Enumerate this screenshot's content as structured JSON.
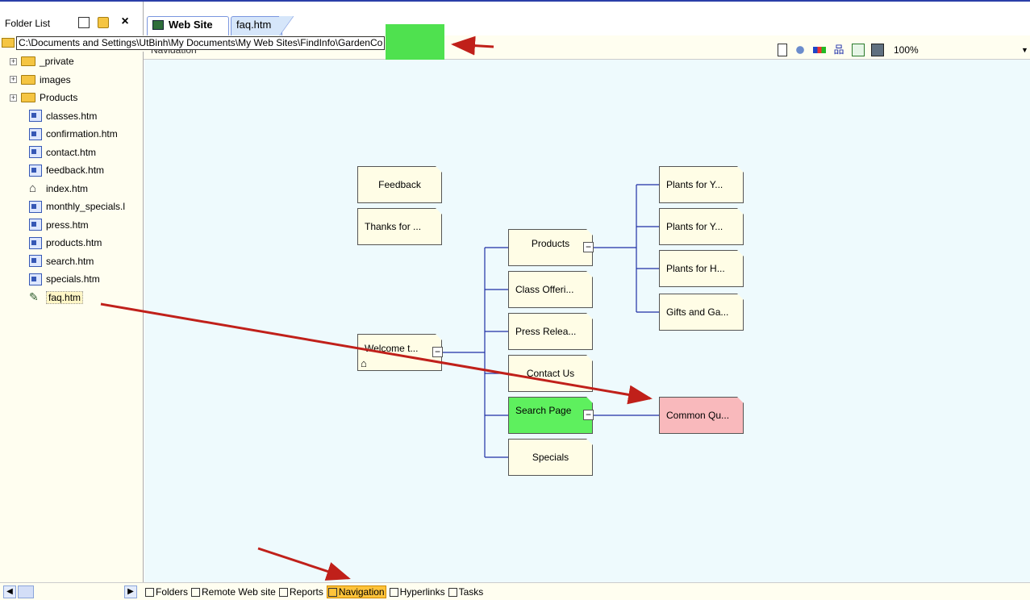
{
  "folder_list": {
    "title": "Folder List",
    "items": [
      {
        "label": "_private",
        "type": "folder"
      },
      {
        "label": "images",
        "type": "folder"
      },
      {
        "label": "Products",
        "type": "folder"
      },
      {
        "label": "classes.htm",
        "type": "page"
      },
      {
        "label": "confirmation.htm",
        "type": "page"
      },
      {
        "label": "contact.htm",
        "type": "page"
      },
      {
        "label": "feedback.htm",
        "type": "page"
      },
      {
        "label": "index.htm",
        "type": "home"
      },
      {
        "label": "monthly_specials.l",
        "type": "page"
      },
      {
        "label": "press.htm",
        "type": "page"
      },
      {
        "label": "products.htm",
        "type": "page"
      },
      {
        "label": "search.htm",
        "type": "page"
      },
      {
        "label": "specials.htm",
        "type": "page"
      },
      {
        "label": "faq.htm",
        "type": "edit"
      }
    ]
  },
  "tabs": [
    "Web Site",
    "faq.htm"
  ],
  "path": "C:\\Documents and Settings\\UtBinh\\My Documents\\My Web Sites\\FindInfo\\GardenCo",
  "view_label": "Navigation",
  "zoom": "100%",
  "nodes": {
    "feedback": "Feedback",
    "thanks": "Thanks for ...",
    "welcome": "Welcome t...",
    "products": "Products",
    "class_offerings": "Class Offeri...",
    "press": "Press Relea...",
    "contact": "Contact Us",
    "search": "Search Page",
    "specials": "Specials",
    "plants1": "Plants for Y...",
    "plants2": "Plants for Y...",
    "plants3": "Plants for H...",
    "gifts": "Gifts and Ga...",
    "common": "Common Qu..."
  },
  "view_tabs": [
    {
      "label": "Folders",
      "active": false
    },
    {
      "label": "Remote Web site",
      "active": false
    },
    {
      "label": "Reports",
      "active": false
    },
    {
      "label": "Navigation",
      "active": true
    },
    {
      "label": "Hyperlinks",
      "active": false
    },
    {
      "label": "Tasks",
      "active": false
    }
  ],
  "colors": {
    "search_node": "#5ef05e",
    "common_node": "#f9b9bc",
    "arrow": "#c0201a",
    "active_view_tab": "#ffc33a"
  }
}
